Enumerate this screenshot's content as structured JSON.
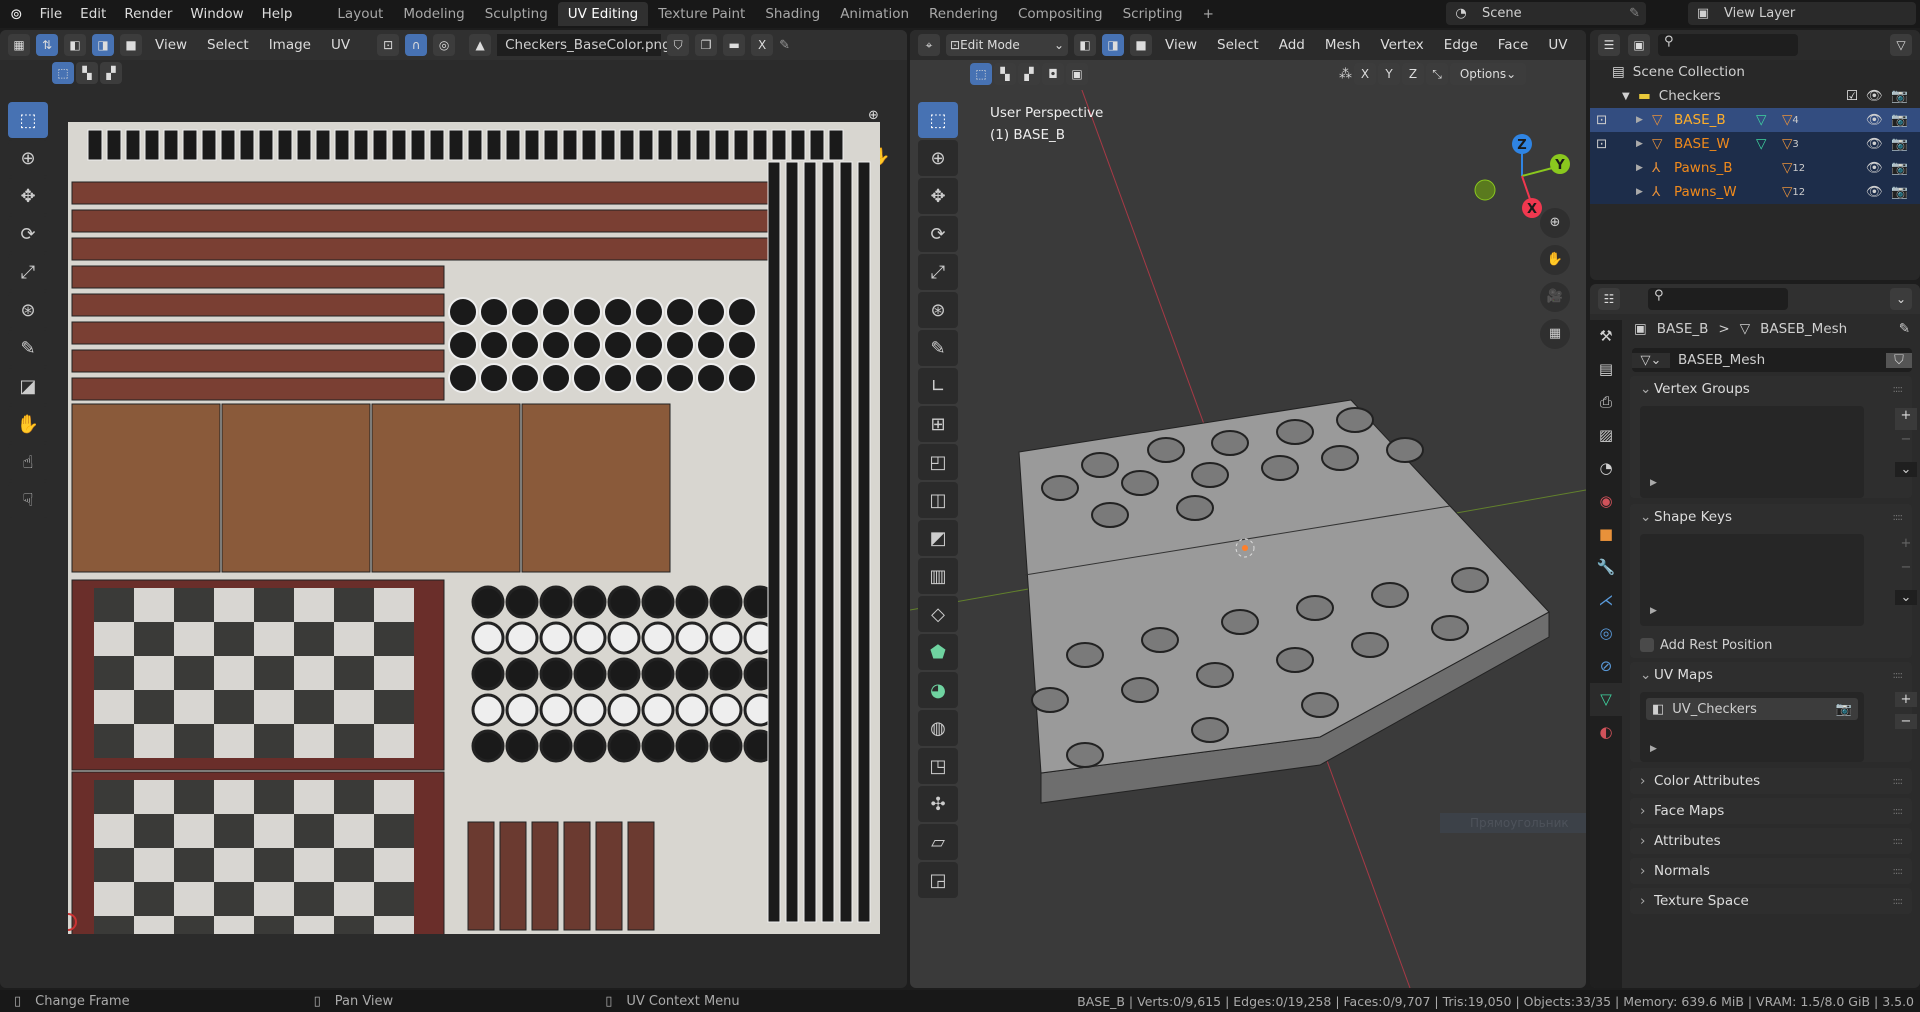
{
  "topbar": {
    "menus": [
      "File",
      "Edit",
      "Render",
      "Window",
      "Help"
    ],
    "workspaces": [
      "Layout",
      "Modeling",
      "Sculpting",
      "UV Editing",
      "Texture Paint",
      "Shading",
      "Animation",
      "Rendering",
      "Compositing",
      "Scripting"
    ],
    "active_workspace": "UV Editing",
    "add_tab": "+",
    "scene": "Scene",
    "view_layer": "View Layer"
  },
  "uv_editor": {
    "menus": [
      "View",
      "Select",
      "Image",
      "UV"
    ],
    "image_name": "Checkers_BaseColor.png",
    "close": "X"
  },
  "viewport": {
    "mode": "Edit Mode",
    "menus": [
      "View",
      "Select",
      "Add",
      "Mesh",
      "Vertex",
      "Edge",
      "Face",
      "UV"
    ],
    "axes": [
      "X",
      "Y",
      "Z"
    ],
    "options": "Options",
    "overlay_title": "User Perspective",
    "overlay_object": "(1) BASE_B",
    "gizmo": {
      "x": "X",
      "y": "Y",
      "z": "Z"
    },
    "tooltip": "Прямоугольник",
    "colors": {
      "x": "#f0384f",
      "y": "#8ac81e",
      "z": "#2f84e3",
      "selected": "#ff7f2a"
    }
  },
  "outliner": {
    "root": "Scene Collection",
    "collection": "Checkers",
    "items": [
      {
        "name": "BASE_B",
        "count": "4",
        "selected": true
      },
      {
        "name": "BASE_W",
        "count": "3"
      },
      {
        "name": "Pawns_B",
        "count": "12"
      },
      {
        "name": "Pawns_W",
        "count": "12"
      }
    ]
  },
  "properties": {
    "breadcrumb_object": "BASE_B",
    "breadcrumb_sep": ">",
    "breadcrumb_data": "BASEB_Mesh",
    "mesh_name": "BASEB_Mesh",
    "panels": {
      "vertex_groups": "Vertex Groups",
      "shape_keys": "Shape Keys",
      "add_rest_position": "Add Rest Position",
      "uv_maps": "UV Maps",
      "uv_map_item": "UV_Checkers",
      "color_attributes": "Color Attributes",
      "face_maps": "Face Maps",
      "attributes": "Attributes",
      "normals": "Normals",
      "texture_space": "Texture Space"
    }
  },
  "status": {
    "hint1": "Change Frame",
    "hint2": "Pan View",
    "hint3": "UV Context Menu",
    "stats": "BASE_B | Verts:0/9,615 | Edges:0/19,258 | Faces:0/9,707 | Tris:19,050 | Objects:33/35 | Memory: 639.6 MiB | VRAM: 1.5/8.0 GiB | 3.5.0"
  }
}
